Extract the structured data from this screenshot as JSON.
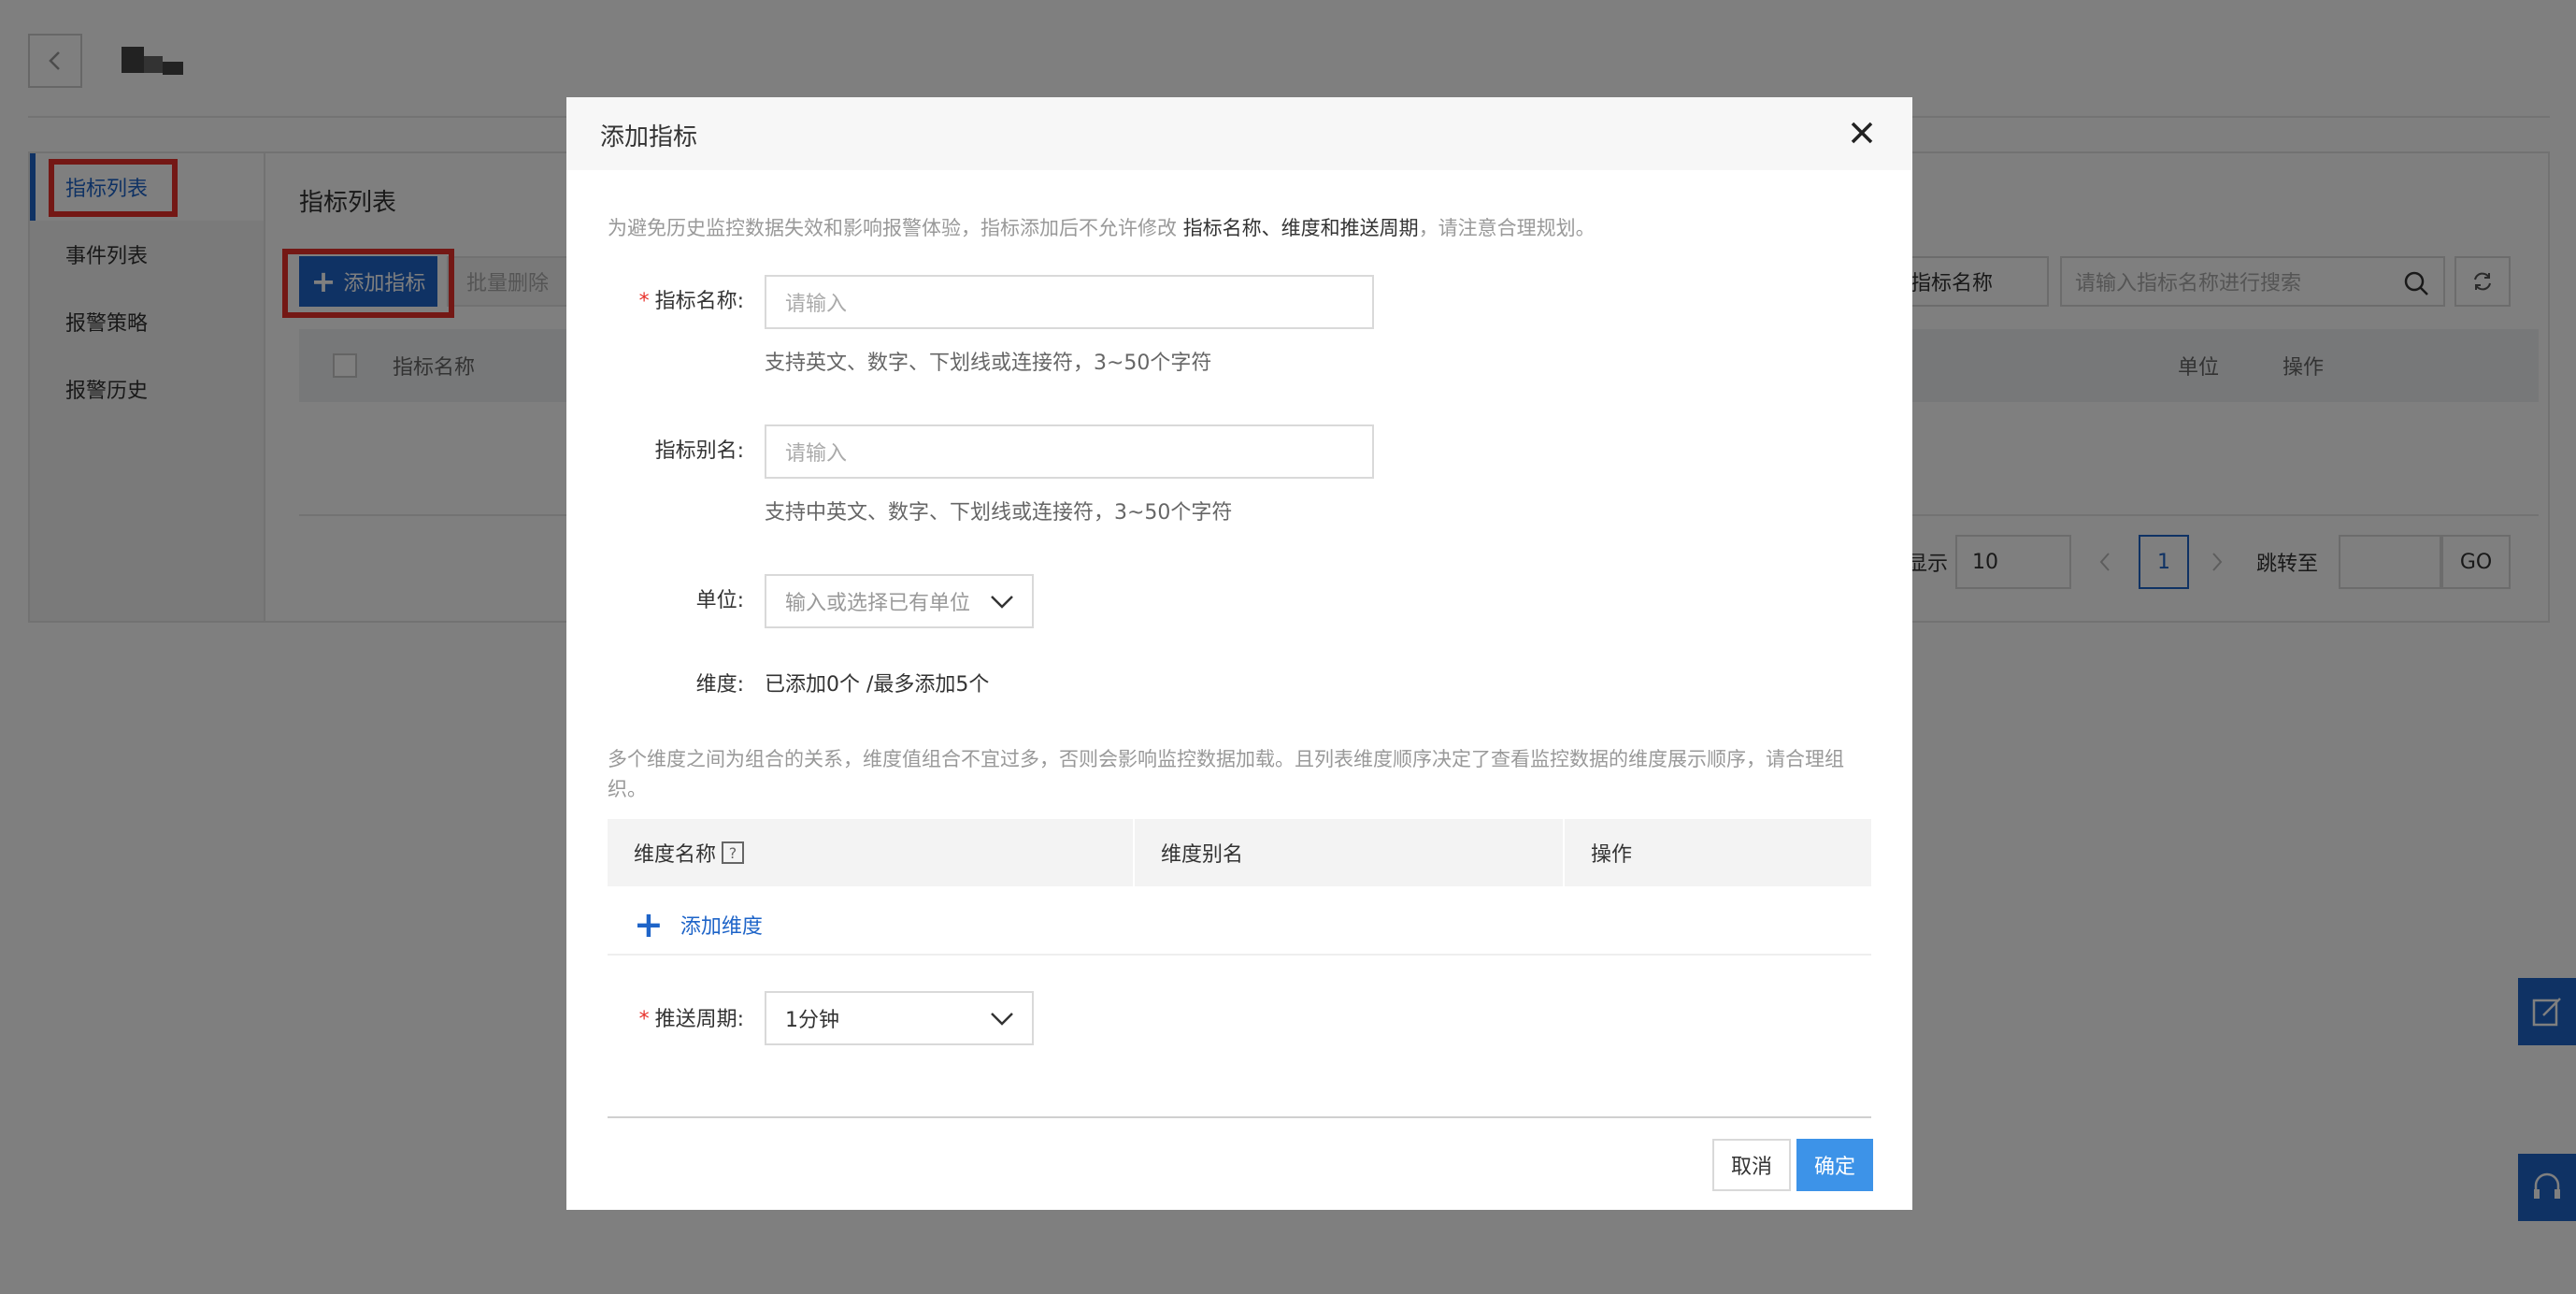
{
  "background": {
    "sidebar": {
      "items": [
        {
          "label": "指标列表",
          "active": true
        },
        {
          "label": "事件列表"
        },
        {
          "label": "报警策略"
        },
        {
          "label": "报警历史"
        }
      ]
    },
    "content": {
      "title": "指标列表",
      "add_button": "添加指标",
      "batch_delete_button": "批量删除",
      "filter_select": "指标名称",
      "search_placeholder": "请输入指标名称进行搜索",
      "table_headers": [
        "指标名称",
        "单位",
        "操作"
      ],
      "pager": {
        "show_label": "显示",
        "page_size": "10",
        "current_page": "1",
        "jump_label": "跳转至",
        "go_label": "GO"
      }
    },
    "colors": {
      "accent": "#1e64c8",
      "highlight": "#e8312a"
    }
  },
  "modal": {
    "title": "添加指标",
    "notice_prefix": "为避免历史监控数据失效和影响报警体验，指标添加后不允许修改 ",
    "notice_bold": "指标名称、维度和推送周期",
    "notice_suffix": "，请注意合理规划。",
    "fields": {
      "name": {
        "label": "指标名称:",
        "required": true,
        "placeholder": "请输入",
        "hint": "支持英文、数字、下划线或连接符，3~50个字符"
      },
      "alias": {
        "label": "指标别名:",
        "placeholder": "请输入",
        "hint": "支持中英文、数字、下划线或连接符，3~50个字符"
      },
      "unit": {
        "label": "单位:",
        "placeholder": "输入或选择已有单位"
      },
      "dimension": {
        "label": "维度:",
        "value": "已添加0个 /最多添加5个"
      }
    },
    "dimension_notice": "多个维度之间为组合的关系，维度值组合不宜过多，否则会影响监控数据加载。且列表维度顺序决定了查看监控数据的维度展示顺序，请合理组织。",
    "dimension_table": {
      "headers": [
        "维度名称",
        "维度别名",
        "操作"
      ],
      "help_icon": "?",
      "add_label": "添加维度"
    },
    "push_period": {
      "label": "推送周期:",
      "required": true,
      "value": "1分钟"
    },
    "cancel_label": "取消",
    "ok_label": "确定",
    "colors": {
      "primary": "#3d93e8",
      "required": "#e8312a"
    }
  }
}
